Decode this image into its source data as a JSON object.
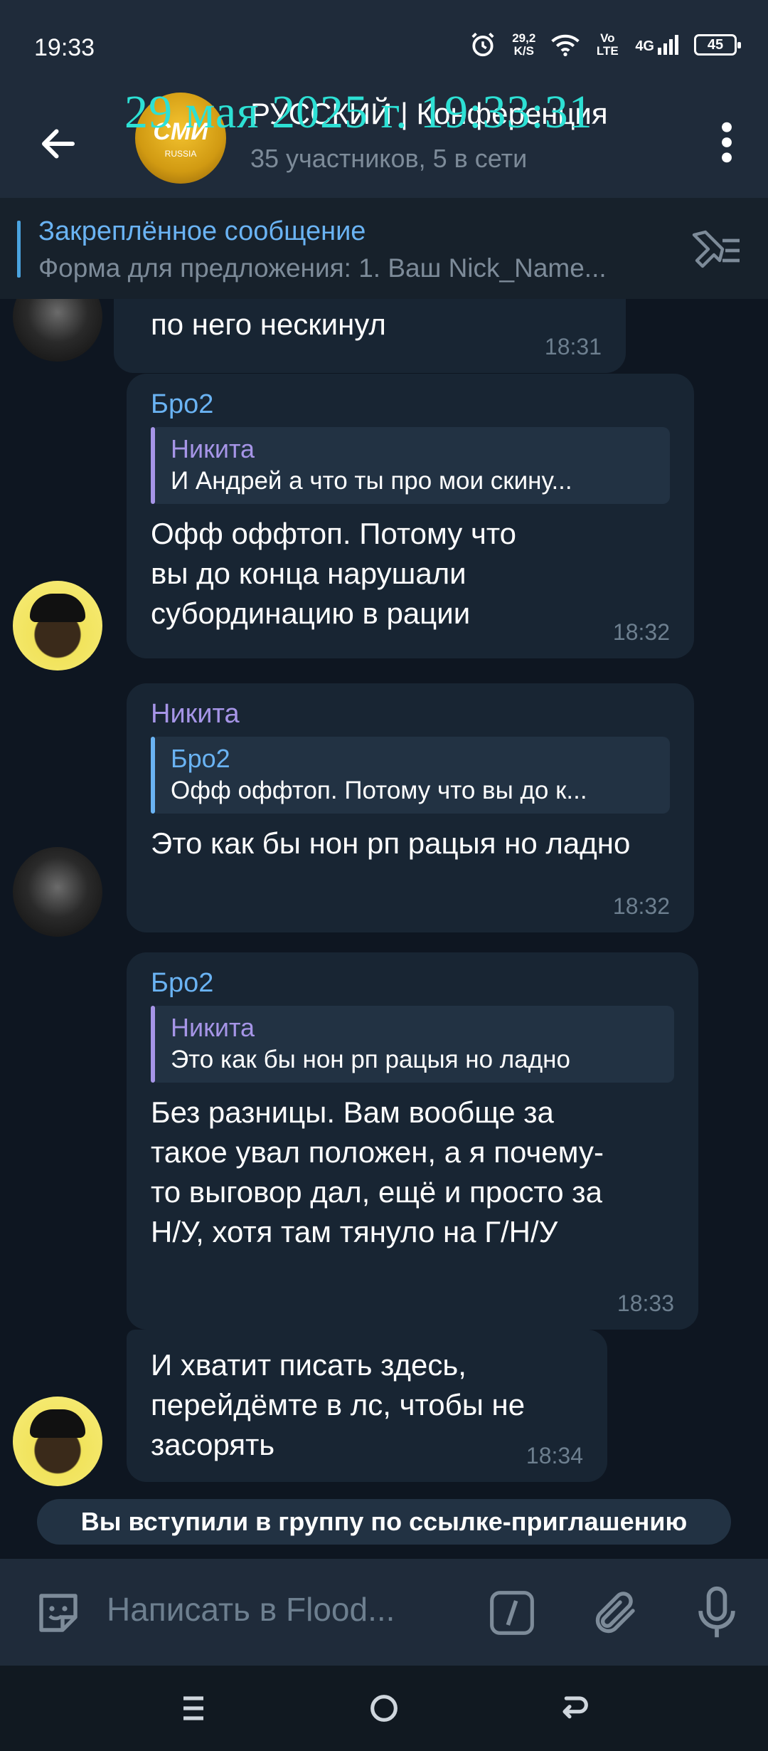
{
  "status_bar": {
    "time": "19:33",
    "net_speed_value": "29,2",
    "net_speed_unit": "K/S",
    "volte": "Vo LTE",
    "network": "4G",
    "battery": "45"
  },
  "header": {
    "title": "РУССКИЙ | Конференция",
    "subtitle": "35 участников, 5 в сети",
    "overlay_timestamp": "29 мая 2025 г. 19:33:31",
    "avatar_logo": "СМИ",
    "avatar_logo_sub": "RUSSIA"
  },
  "pinned": {
    "title": "Закреплённое сообщение",
    "text": "Форма для предложения:  1. Ваш Nick_Name..."
  },
  "messages": [
    {
      "text": "по него нескинул",
      "time": "18:31"
    },
    {
      "author": "Бро2",
      "reply_author": "Никита",
      "reply_text": "И Андрей а что ты про мои скину...",
      "text": "Офф оффтоп. Потому что вы до конца нарушали субординацию в рации",
      "time": "18:32"
    },
    {
      "author": "Никита",
      "reply_author": "Бро2",
      "reply_text": "Офф оффтоп. Потому что вы до к...",
      "text": "Это как бы нон рп рацыя но ладно",
      "time": "18:32"
    },
    {
      "author": "Бро2",
      "reply_author": "Никита",
      "reply_text": "Это как бы нон рп рацыя но ладно",
      "text": "Без разницы. Вам вообще за такое увал положен, а я почему-то выговор дал, ещё и просто за Н/У, хотя там тянуло на Г/Н/У",
      "time": "18:33"
    },
    {
      "text": "И хватит писать здесь, перейдёмте в лс, чтобы не засорять",
      "time": "18:34"
    }
  ],
  "service_message": "Вы вступили в группу по ссылке-приглашению",
  "composer": {
    "placeholder": "Написать в Flood..."
  },
  "colors": {
    "background": "#0e1621",
    "bubble": "#182533",
    "accent_blue": "#6ab3f3",
    "accent_purple": "#a695e7",
    "overlay": "#2de0d4"
  },
  "icons": {
    "back": "arrow-left-icon",
    "menu": "more-vertical-icon",
    "unpin": "pin-list-icon",
    "sticker": "sticker-icon",
    "command": "slash-command-icon",
    "attach": "paperclip-icon",
    "mic": "microphone-icon",
    "nav_menu": "menu-icon",
    "nav_home": "home-circle-icon",
    "nav_back": "back-icon"
  }
}
